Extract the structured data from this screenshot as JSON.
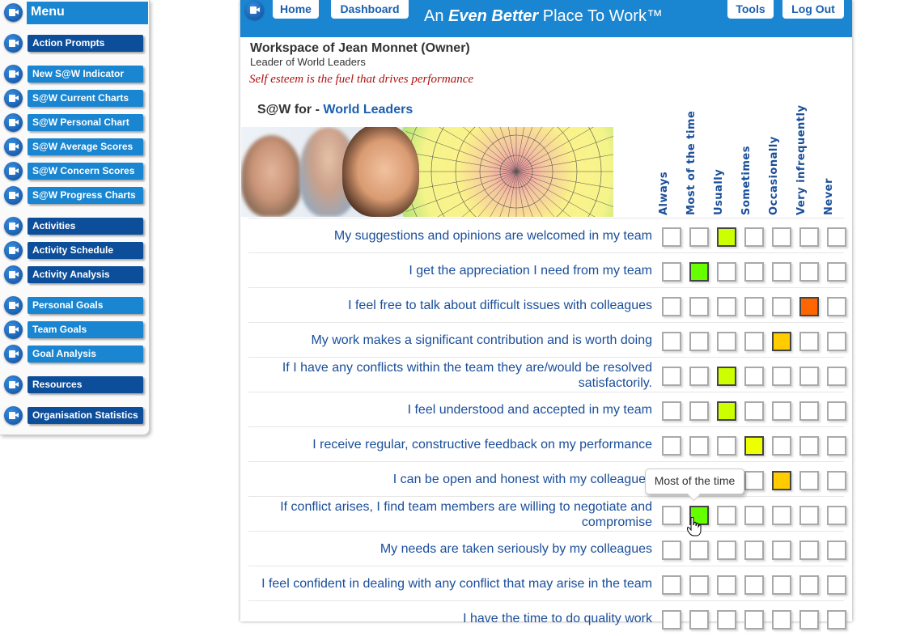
{
  "sidebar": {
    "title": "Menu",
    "items": [
      {
        "label": "Action Prompts",
        "style": "dark"
      },
      {
        "label": "New S@W Indicator",
        "style": "light"
      },
      {
        "label": "S@W Current Charts",
        "style": "light"
      },
      {
        "label": "S@W Personal Chart",
        "style": "light"
      },
      {
        "label": "S@W Average Scores",
        "style": "light"
      },
      {
        "label": "S@W Concern Scores",
        "style": "light"
      },
      {
        "label": "S@W Progress Charts",
        "style": "light"
      },
      {
        "label": "Activities",
        "style": "dark"
      },
      {
        "label": "Activity Schedule",
        "style": "dark"
      },
      {
        "label": "Activity Analysis",
        "style": "dark"
      },
      {
        "label": "Personal Goals",
        "style": "light"
      },
      {
        "label": "Team Goals",
        "style": "light"
      },
      {
        "label": "Goal Analysis",
        "style": "light"
      },
      {
        "label": "Resources",
        "style": "dark"
      },
      {
        "label": "Organisation Statistics",
        "style": "dark"
      }
    ]
  },
  "header": {
    "home_label": "Home",
    "dashboard_label": "Dashboard",
    "tools_label": "Tools",
    "logout_label": "Log Out",
    "title_prefix": "An ",
    "title_emphasis": "Even Better",
    "title_suffix": " Place To Work™"
  },
  "workspace": {
    "title": "Workspace of Jean Monnet (Owner)",
    "subtitle": "Leader of World Leaders",
    "motto": "Self esteem is the fuel that drives performance",
    "saw_for_label": "S@W for - ",
    "group_name": "World Leaders"
  },
  "scale": {
    "options": [
      "Always",
      "Most of the time",
      "Usually",
      "Sometimes",
      "Occasionally",
      "Very infrequently",
      "Never"
    ],
    "colors": [
      "#33cc00",
      "#66ff00",
      "#ccff00",
      "#eeff00",
      "#ffcc00",
      "#ff6600",
      "#ff0000"
    ]
  },
  "questions": [
    {
      "text": "My suggestions and opinions are welcomed in my team",
      "selected": 2
    },
    {
      "text": "I get the appreciation I need from my team",
      "selected": 1
    },
    {
      "text": "I feel free to talk about difficult issues with colleagues",
      "selected": 5
    },
    {
      "text": "My work makes a significant contribution and is worth doing",
      "selected": 4
    },
    {
      "text": "If I have any conflicts within the team they are/would be resolved satisfactorily.",
      "selected": 2
    },
    {
      "text": "I feel understood and accepted in my team",
      "selected": 2
    },
    {
      "text": "I receive regular, constructive feedback on my performance",
      "selected": 3
    },
    {
      "text": "I can be open and honest with my colleagues",
      "selected": 4
    },
    {
      "text": "If conflict arises, I find team members are willing to negotiate and compromise",
      "selected": 1,
      "hover": true
    },
    {
      "text": "My needs are taken seriously by my colleagues",
      "selected": null
    },
    {
      "text": "I feel confident in dealing with any conflict that may arise in the team",
      "selected": null
    },
    {
      "text": "I have the time to do quality work",
      "selected": null
    }
  ],
  "tooltip": {
    "text": "Most of the time"
  }
}
